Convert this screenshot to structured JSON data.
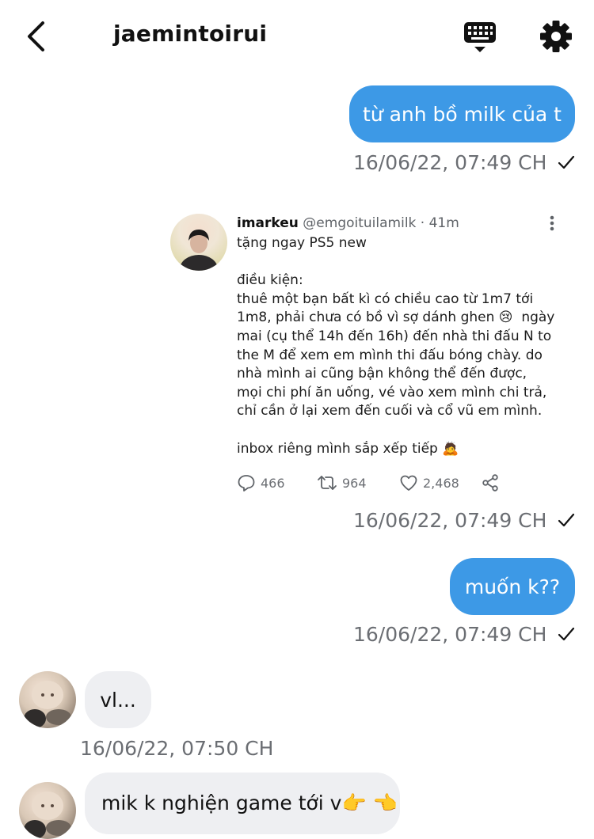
{
  "header": {
    "title": "jaemintoirui",
    "back_icon": "chevron-left-icon",
    "keyboard_icon": "keyboard-icon",
    "settings_icon": "gear-icon"
  },
  "messages": [
    {
      "direction": "out",
      "text": "từ anh bồ milk của t",
      "timestamp": "16/06/22, 07:49 CH",
      "status": "check-icon"
    },
    {
      "direction": "out",
      "type": "shared-tweet",
      "tweet": {
        "author": "imarkeu",
        "handle": "@emgoituilamilk",
        "time": "· 41m",
        "text": "tặng ngay PS5 new\n\nđiều kiện:\nthuê một bạn bất kì có chiều cao từ 1m7 tới\n1m8, phải chưa có bồ vì sợ dánh ghen 😢  ngày\nmai (cụ thể 14h đến 16h) đến nhà thi đấu N to\nthe M để xem em mình thi đấu bóng chày. do\nnhà mình ai cũng bận không thể đến được,\nmọi chi phí ăn uống, vé vào xem mình chi trả,\nchỉ cần ở lại xem đến cuối và cổ vũ em mình.\n\ninbox riêng mình sắp xếp tiếp 🙇",
        "replies": "466",
        "retweets": "964",
        "likes": "2,468"
      },
      "timestamp": "16/06/22, 07:49 CH",
      "status": "check-icon"
    },
    {
      "direction": "out",
      "text": "muốn k??",
      "timestamp": "16/06/22, 07:49 CH",
      "status": "check-icon"
    },
    {
      "direction": "in",
      "text": "vl...",
      "timestamp": "16/06/22, 07:50 CH"
    },
    {
      "direction": "in",
      "text": "mik k nghiện game tới v👉 👈"
    }
  ],
  "colors": {
    "outgoing_bubble": "#3d99e6",
    "incoming_bubble": "#eeeff2",
    "timestamp": "#6b6e73"
  }
}
